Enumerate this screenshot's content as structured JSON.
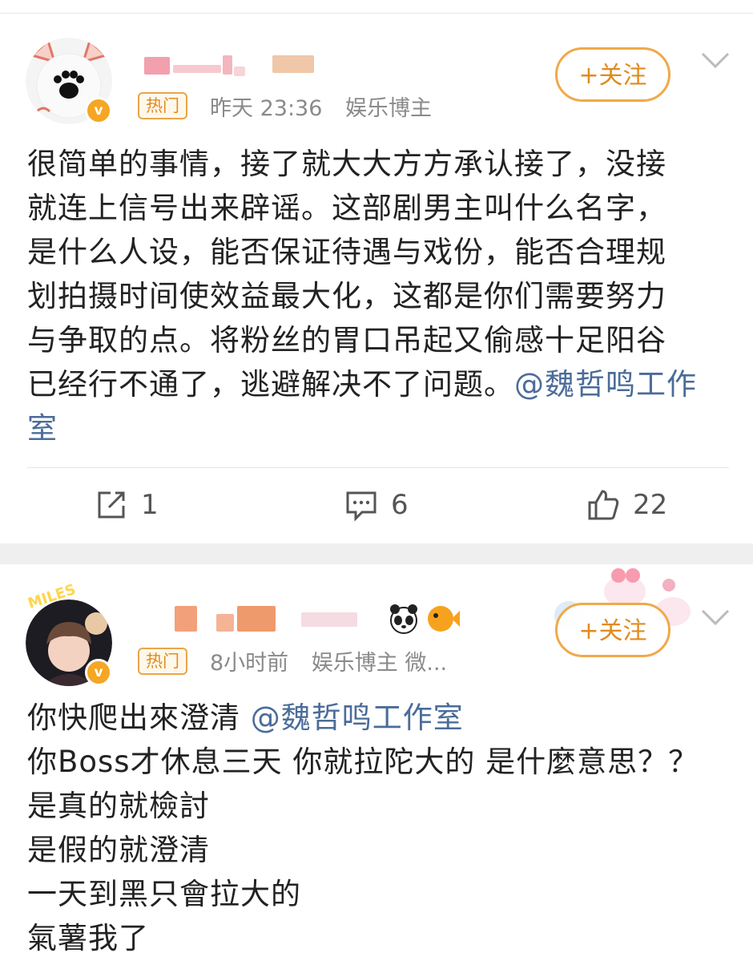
{
  "post1": {
    "author_name_blurred": true,
    "hot_tag": "热门",
    "time": "昨天 23:36",
    "tag": "娱乐博主",
    "follow_label": "+关注",
    "verified_badge": "v",
    "content_lines": [
      "很简单的事情，接了就大大方方承认接了，没接",
      "就连上信号出来辟谣。这部剧男主叫什么名字，",
      "是什么人设，能否保证待遇与戏份，能否合理规",
      "划拍摄时间使效益最大化，这都是你们需要努力",
      "与争取的点。将粉丝的胃口吊起又偷感十足阳谷",
      "已经行不通了，逃避解决不了问题。"
    ],
    "mention_head": "@魏哲鸣工作",
    "mention_tail": "室",
    "actions": {
      "repost_count": "1",
      "comment_count": "6",
      "like_count": "22"
    }
  },
  "post2": {
    "author_name_blurred": true,
    "hot_tag": "热门",
    "time": "8小时前",
    "tag": "娱乐博主 微...",
    "follow_label": "+关注",
    "verified_badge": "v",
    "first_line": "你快爬出來澄清 ",
    "mention": "@魏哲鸣工作室",
    "content_lines": [
      "你Boss才休息三天 你就拉陀大的 是什麼意思？？",
      "是真的就檢討",
      "是假的就澄清",
      "一天到黑只會拉大的",
      "氣薯我了"
    ],
    "avatar_text": "MILES"
  },
  "colors": {
    "accent": "#e08b1e",
    "mention": "#4b6c9a",
    "separator": "#efefef"
  },
  "icons": [
    "paw-icon",
    "repost-icon",
    "comment-icon",
    "like-icon",
    "chevron-down-icon",
    "panda-emoji-icon",
    "fish-emoji-icon"
  ]
}
